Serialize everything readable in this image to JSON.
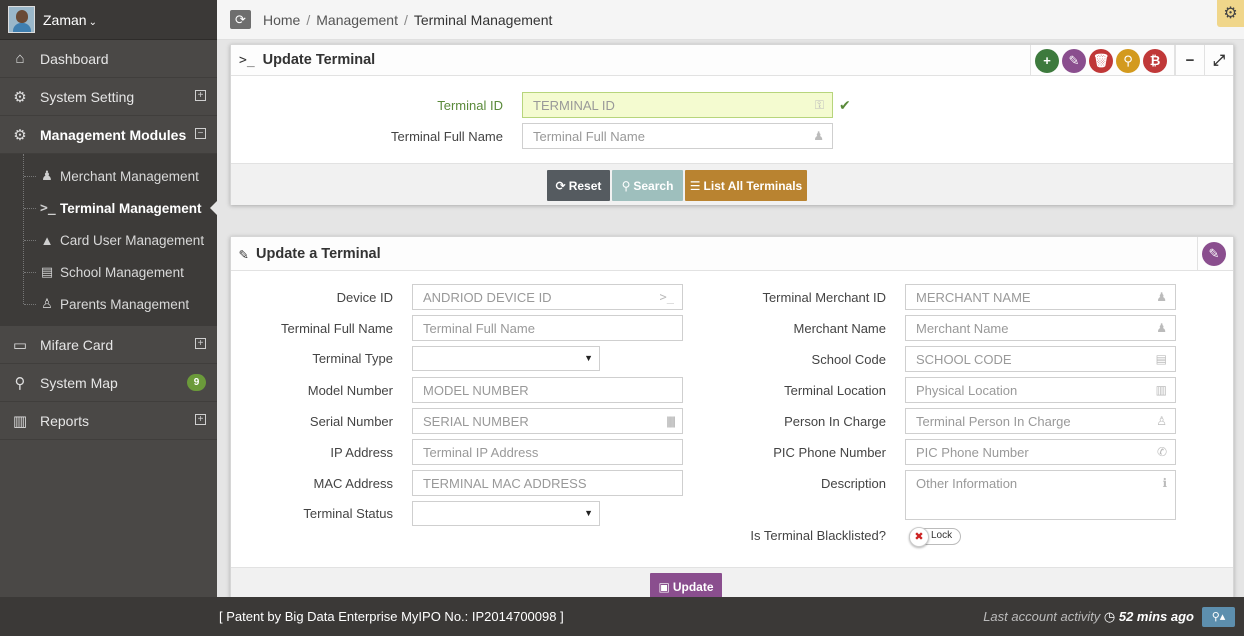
{
  "user": {
    "name": "Zaman"
  },
  "sidebar": {
    "items": [
      {
        "label": "Dashboard",
        "icon": "home-icon"
      },
      {
        "label": "System Setting",
        "icon": "cogs-icon",
        "toggle": "+"
      },
      {
        "label": "Management Modules",
        "icon": "cogs-icon",
        "toggle": "−",
        "active": true
      },
      {
        "label": "Mifare Card",
        "icon": "credit-card-icon",
        "toggle": "+"
      },
      {
        "label": "System Map",
        "icon": "map-marker-icon",
        "badge": "9"
      },
      {
        "label": "Reports",
        "icon": "bar-chart-icon",
        "toggle": "+"
      }
    ],
    "submenu": [
      {
        "label": "Merchant Management",
        "icon": "male-icon"
      },
      {
        "label": "Terminal Management",
        "icon": "terminal-icon",
        "active": true
      },
      {
        "label": "Card User Management",
        "icon": "graduation-cap-icon"
      },
      {
        "label": "School Management",
        "icon": "school-icon"
      },
      {
        "label": "Parents Management",
        "icon": "parent-icon"
      }
    ]
  },
  "breadcrumb": {
    "home": "Home",
    "section": "Management",
    "current": "Terminal Management",
    "separator": "/"
  },
  "search_panel": {
    "title": "Update Terminal",
    "terminal_id_label": "Terminal ID",
    "terminal_id_placeholder": "TERMINAL ID",
    "full_name_label": "Terminal Full Name",
    "full_name_placeholder": "Terminal Full Name",
    "buttons": {
      "reset": "Reset",
      "search": "Search",
      "list_all": "List All Terminals"
    },
    "tools": [
      {
        "icon": "plus-icon",
        "color": "#3d7a3d"
      },
      {
        "icon": "edit-icon",
        "color": "#8a4e8e"
      },
      {
        "icon": "trash-icon",
        "color": "#c03838"
      },
      {
        "icon": "search-icon",
        "color": "#d39a1e"
      },
      {
        "icon": "bitcoin-icon",
        "color": "#c03838"
      }
    ]
  },
  "update_panel": {
    "title": "Update a Terminal",
    "left_fields": [
      {
        "label": "Device ID",
        "placeholder": "ANDRIOD DEVICE ID",
        "icon": "terminal-icon",
        "type": "input"
      },
      {
        "label": "Terminal Full Name",
        "placeholder": "Terminal Full Name",
        "type": "input"
      },
      {
        "label": "Terminal Type",
        "type": "select"
      },
      {
        "label": "Model Number",
        "placeholder": "MODEL NUMBER",
        "type": "input"
      },
      {
        "label": "Serial Number",
        "placeholder": "SERIAL NUMBER",
        "icon": "barcode-icon",
        "type": "input"
      },
      {
        "label": "IP Address",
        "placeholder": "Terminal IP Address",
        "type": "input"
      },
      {
        "label": "MAC Address",
        "placeholder": "TERMINAL MAC ADDRESS",
        "type": "input"
      },
      {
        "label": "Terminal Status",
        "type": "select"
      }
    ],
    "right_fields": [
      {
        "label": "Terminal Merchant ID",
        "placeholder": "MERCHANT NAME",
        "icon": "male-icon"
      },
      {
        "label": "Merchant Name",
        "placeholder": "Merchant Name",
        "icon": "male-icon"
      },
      {
        "label": "School Code",
        "placeholder": "SCHOOL CODE",
        "icon": "school-icon"
      },
      {
        "label": "Terminal Location",
        "placeholder": "Physical Location",
        "icon": "building-icon"
      },
      {
        "label": "Person In Charge",
        "placeholder": "Terminal Person In Charge",
        "icon": "user-tie-icon"
      },
      {
        "label": "PIC Phone Number",
        "placeholder": "PIC Phone Number",
        "icon": "phone-icon"
      }
    ],
    "description_label": "Description",
    "description_placeholder": "Other Information",
    "blacklist_label": "Is Terminal Blacklisted?",
    "lock_label": "Lock",
    "update_button": "Update"
  },
  "footer": {
    "patent": "[ Patent by Big Data Enterprise   MyIPO No.: IP2014700098 ]",
    "activity_label": "Last account activity",
    "activity_time": "52 mins ago"
  }
}
